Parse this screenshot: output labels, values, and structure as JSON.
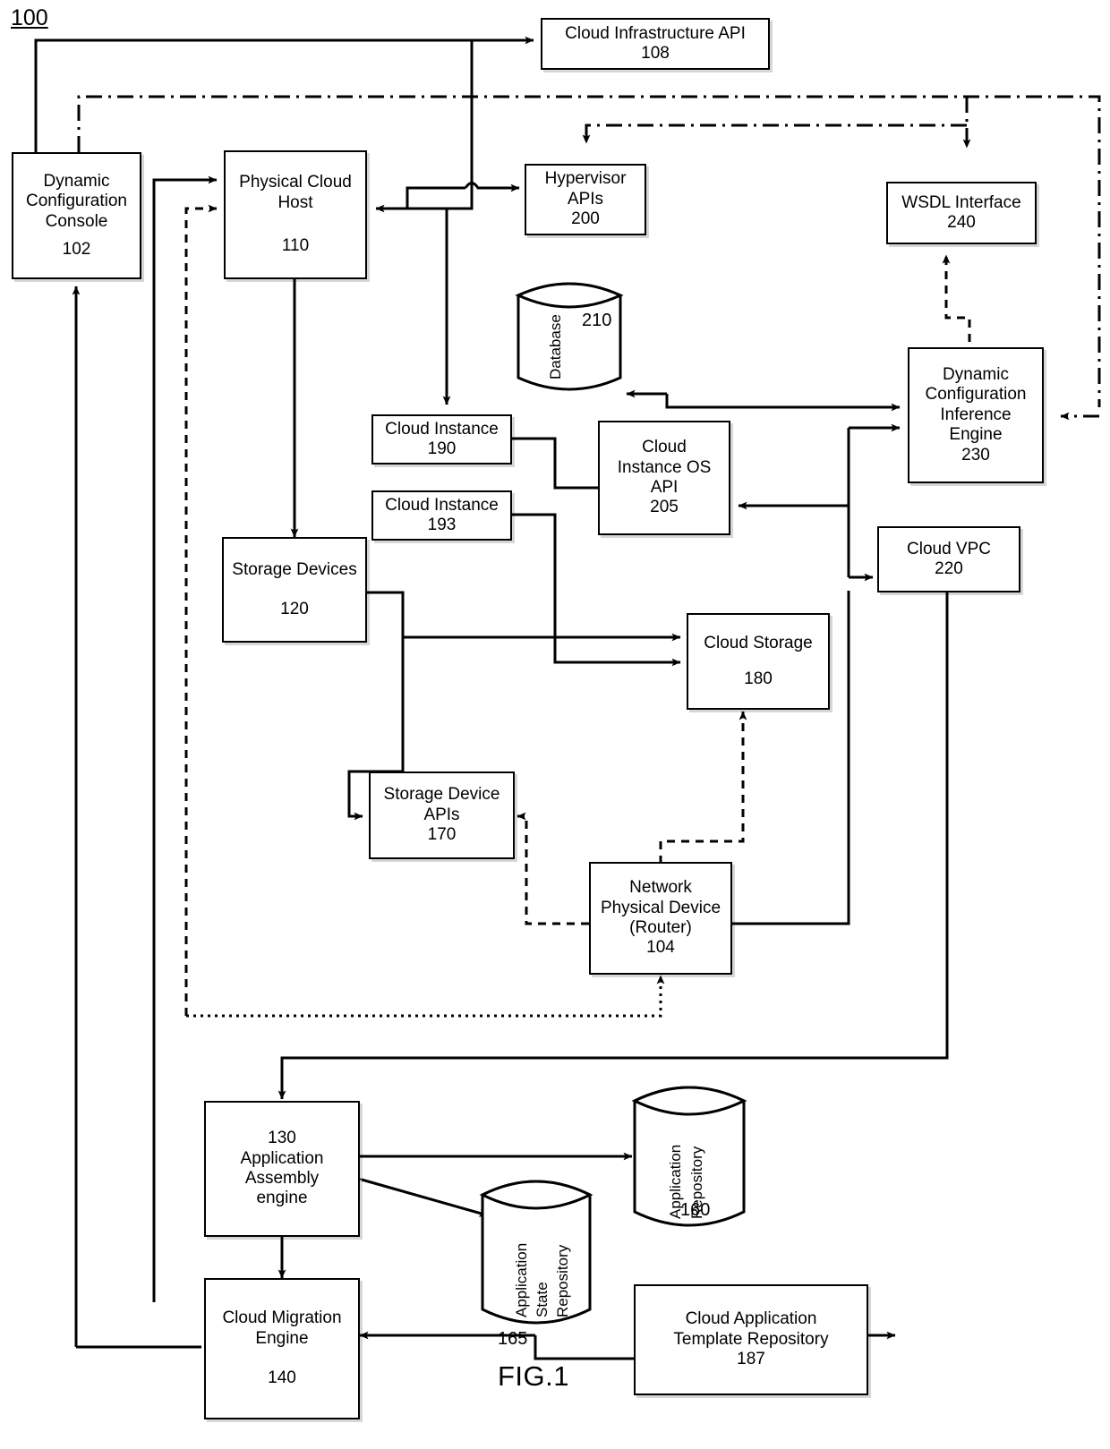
{
  "figure": {
    "system_label": "100",
    "caption": "FIG.1"
  },
  "nodes": {
    "dynamic_configuration_console": {
      "lines": [
        "Dynamic",
        "Configuration",
        "Console"
      ],
      "ref": "102"
    },
    "physical_cloud_host": {
      "lines": [
        "Physical Cloud",
        "Host"
      ],
      "ref": "110"
    },
    "cloud_infrastructure_api": {
      "lines": [
        "Cloud Infrastructure API"
      ],
      "ref": "108"
    },
    "hypervisor_apis": {
      "lines": [
        "Hypervisor",
        "APIs"
      ],
      "ref": "200"
    },
    "wsdl_interface": {
      "lines": [
        "WSDL Interface"
      ],
      "ref": "240"
    },
    "database": {
      "label": "Database",
      "ref": "210"
    },
    "cloud_instance_190": {
      "lines": [
        "Cloud Instance"
      ],
      "ref": "190"
    },
    "cloud_instance_193": {
      "lines": [
        "Cloud Instance"
      ],
      "ref": "193"
    },
    "cloud_instance_os_api": {
      "lines": [
        "Cloud",
        "Instance OS",
        "API"
      ],
      "ref": "205"
    },
    "dynamic_configuration_inference_engine": {
      "lines": [
        "Dynamic",
        "Configuration",
        "Inference",
        "Engine"
      ],
      "ref": "230"
    },
    "storage_devices": {
      "lines": [
        "Storage Devices"
      ],
      "ref": "120"
    },
    "cloud_vpc": {
      "lines": [
        "Cloud VPC"
      ],
      "ref": "220"
    },
    "cloud_storage": {
      "lines": [
        "Cloud Storage"
      ],
      "ref": "180"
    },
    "storage_device_apis": {
      "lines": [
        "Storage Device",
        "APIs"
      ],
      "ref": "170"
    },
    "network_physical_device": {
      "lines": [
        "Network",
        "Physical Device",
        "(Router)"
      ],
      "ref": "104"
    },
    "application_assembly_engine": {
      "lines": [
        "130",
        "Application",
        "Assembly",
        "engine"
      ],
      "ref": ""
    },
    "application_repository": {
      "label_lines": [
        "Application",
        "Repository"
      ],
      "ref": "160"
    },
    "application_state_repository": {
      "label_lines": [
        "Application",
        "State",
        "Repository"
      ],
      "ref": "165"
    },
    "cloud_migration_engine": {
      "lines": [
        "Cloud Migration",
        "Engine"
      ],
      "ref": "140"
    },
    "cloud_application_template_repository": {
      "lines": [
        "Cloud Application",
        "Template Repository"
      ],
      "ref": "187"
    }
  },
  "style": {
    "stroke": "#000000",
    "fill": "#ffffff",
    "shadow": "rgba(0,0,0,0.16)"
  }
}
